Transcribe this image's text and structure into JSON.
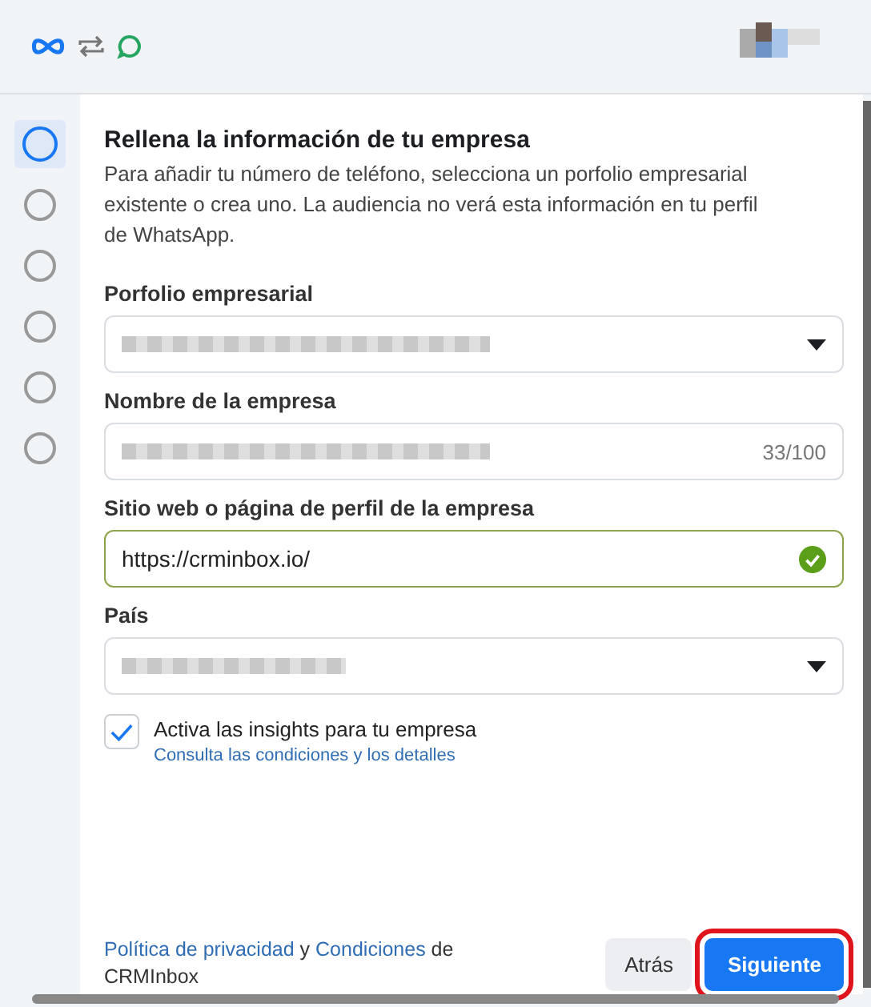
{
  "steps": [
    {
      "selected": true
    },
    {
      "selected": false
    },
    {
      "selected": false
    },
    {
      "selected": false
    },
    {
      "selected": false
    },
    {
      "selected": false
    }
  ],
  "heading": "Rellena la información de tu empresa",
  "description": "Para añadir tu número de teléfono, selecciona un porfolio empresarial existente o crea uno. La audiencia no verá esta información en tu perfil de WhatsApp.",
  "fields": [
    {
      "kind": "dropdown",
      "label": "Porfolio empresarial",
      "redacted": true
    },
    {
      "kind": "text",
      "label": "Nombre de la empresa",
      "redacted": true,
      "counter": "33/100"
    },
    {
      "kind": "text",
      "label": "Sitio web o página de perfil de la empresa",
      "value": "https://crminbox.io/",
      "valid": true
    },
    {
      "kind": "dropdown",
      "label": "País",
      "redacted": true
    }
  ],
  "insights": {
    "checked": true,
    "label": "Activa las insights para tu empresa",
    "link": "Consulta las condiciones y los detalles"
  },
  "footer": {
    "privacy_link": "Política de privacidad",
    "and": "y",
    "terms_link": "Condiciones",
    "suffix": "de CRMInbox"
  },
  "buttons": [
    {
      "label": "Atrás",
      "primary": false,
      "highlighted": false
    },
    {
      "label": "Siguiente",
      "primary": true,
      "highlighted": true
    }
  ]
}
